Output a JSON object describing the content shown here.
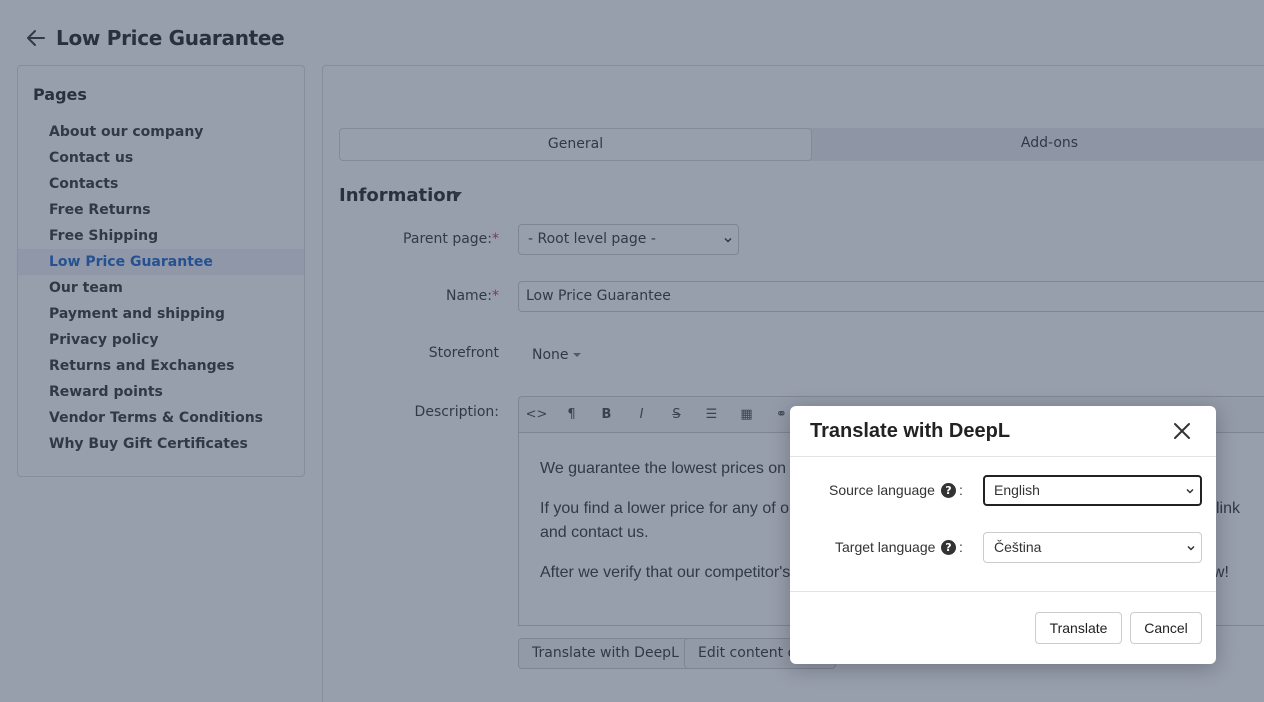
{
  "page": {
    "title": "Low Price Guarantee"
  },
  "sidebar": {
    "title": "Pages",
    "items": [
      {
        "label": "About our company"
      },
      {
        "label": "Contact us"
      },
      {
        "label": "Contacts"
      },
      {
        "label": "Free Returns"
      },
      {
        "label": "Free Shipping"
      },
      {
        "label": "Low Price Guarantee",
        "active": true
      },
      {
        "label": "Our team"
      },
      {
        "label": "Payment and shipping"
      },
      {
        "label": "Privacy policy"
      },
      {
        "label": "Returns and Exchanges"
      },
      {
        "label": "Reward points"
      },
      {
        "label": "Vendor Terms & Conditions"
      },
      {
        "label": "Why Buy Gift Certificates"
      }
    ]
  },
  "tabs": [
    {
      "label": "General",
      "active": true
    },
    {
      "label": "Add-ons"
    }
  ],
  "section": {
    "title": "Information"
  },
  "form": {
    "parent_page": {
      "label": "Parent page:",
      "required_mark": "*",
      "value": "- Root level page -"
    },
    "name": {
      "label": "Name:",
      "required_mark": "*",
      "value": "Low Price Guarantee"
    },
    "storefront": {
      "label": "Storefront",
      "value": "None"
    },
    "description": {
      "label": "Description:",
      "toolbar": [
        {
          "glyph": "<>",
          "icon": "code-icon"
        },
        {
          "glyph": "¶",
          "icon": "paragraph-icon"
        },
        {
          "glyph": "B",
          "icon": "bold-icon"
        },
        {
          "glyph": "I",
          "icon": "italic-icon"
        },
        {
          "glyph": "S",
          "icon": "strikethrough-icon"
        },
        {
          "glyph": "☰",
          "icon": "list-icon"
        },
        {
          "glyph": "▦",
          "icon": "table-icon"
        },
        {
          "glyph": "⚭",
          "icon": "link-icon"
        }
      ],
      "paragraphs": [
        "We guarantee the lowest prices on",
        "If you find a lower price for any of o",
        "and contact us.",
        "After we verify that our competitor's"
      ],
      "paragraph_tails": [
        "link",
        "ow!"
      ]
    }
  },
  "actions": {
    "translate_deepl": "Translate with DeepL",
    "edit_content": "Edit content o"
  },
  "modal": {
    "title": "Translate with DeepL",
    "source_label": "Source language",
    "source_value": "English",
    "target_label": "Target language",
    "target_value": "Čeština",
    "help_glyph": "?",
    "colon": ":",
    "translate_button": "Translate",
    "cancel_button": "Cancel"
  },
  "colors": {
    "overlay": "#303e5a",
    "active_link": "#1a64c8",
    "required": "#dd3333"
  }
}
